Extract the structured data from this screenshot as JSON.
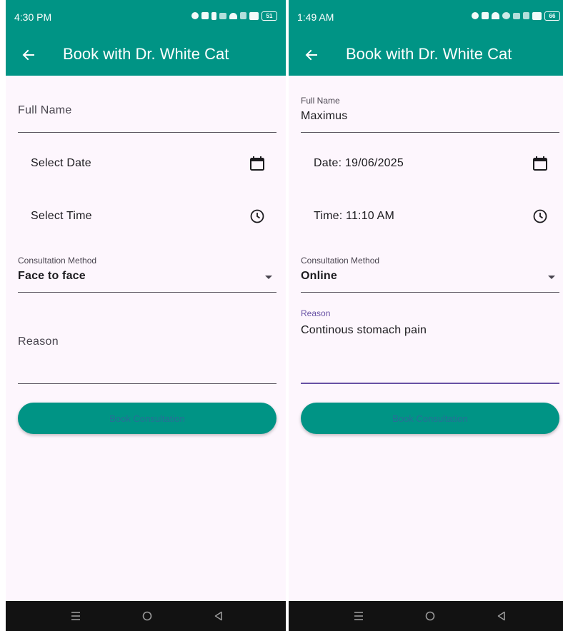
{
  "colors": {
    "primary": "#009485",
    "background": "#fdf6fd",
    "focus": "#6750a4",
    "navbar": "#121212"
  },
  "screens": [
    {
      "status": {
        "time": "4:30 PM",
        "battery": "51"
      },
      "appbar": {
        "title": "Book with Dr. White Cat"
      },
      "full_name": {
        "placeholder": "Full Name"
      },
      "date_tile": {
        "label": "Select Date"
      },
      "time_tile": {
        "label": "Select Time"
      },
      "consultation": {
        "label": "Consultation Method",
        "value": "Face to face"
      },
      "reason": {
        "placeholder": "Reason"
      },
      "book_button": {
        "label": "Book Consultation"
      },
      "icons": {
        "back": "arrow-left-icon",
        "calendar": "calendar-icon",
        "clock": "clock-icon",
        "dropdown": "dropdown-arrow-icon"
      }
    },
    {
      "status": {
        "time": "1:49 AM",
        "battery": "66"
      },
      "appbar": {
        "title": "Book with Dr. White Cat"
      },
      "full_name": {
        "label": "Full Name",
        "value": "Maximus"
      },
      "date_tile": {
        "label": "Date: 19/06/2025"
      },
      "time_tile": {
        "label": "Time: 11:10 AM"
      },
      "consultation": {
        "label": "Consultation Method",
        "value": "Online"
      },
      "reason": {
        "label": "Reason",
        "value": "Continous stomach pain"
      },
      "book_button": {
        "label": "Book Consultation"
      },
      "icons": {
        "back": "arrow-left-icon",
        "calendar": "calendar-icon",
        "clock": "clock-icon",
        "dropdown": "dropdown-arrow-icon"
      }
    }
  ]
}
